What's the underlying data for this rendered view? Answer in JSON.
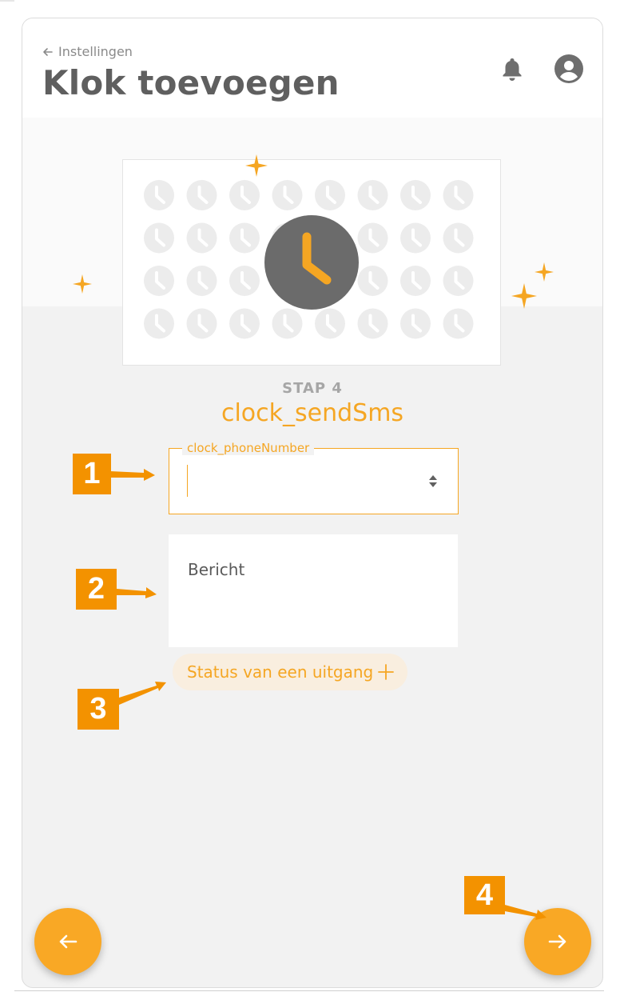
{
  "header": {
    "breadcrumb": "Instellingen",
    "title": "Klok toevoegen",
    "icons": [
      "bell-icon",
      "account-circle-icon",
      "arrow-left-icon"
    ]
  },
  "step": {
    "label": "STAP 4",
    "title": "clock_sendSms"
  },
  "form": {
    "phone_label": "clock_phoneNumber",
    "phone_value": "",
    "message_placeholder": "Bericht",
    "status_chip_label": "Status van een uitgang",
    "status_chip_icon": "plus-icon"
  },
  "navigation": {
    "back_icon": "arrow-left-icon",
    "next_icon": "arrow-right-icon"
  },
  "callouts": [
    "1",
    "2",
    "3",
    "4"
  ],
  "colors": {
    "accent": "#f5a623",
    "fab": "#f9a825",
    "callout": "#f39200",
    "title": "#5f5f5f",
    "clock_face": "#6b6b6b",
    "pattern_clock": "#ececec"
  }
}
